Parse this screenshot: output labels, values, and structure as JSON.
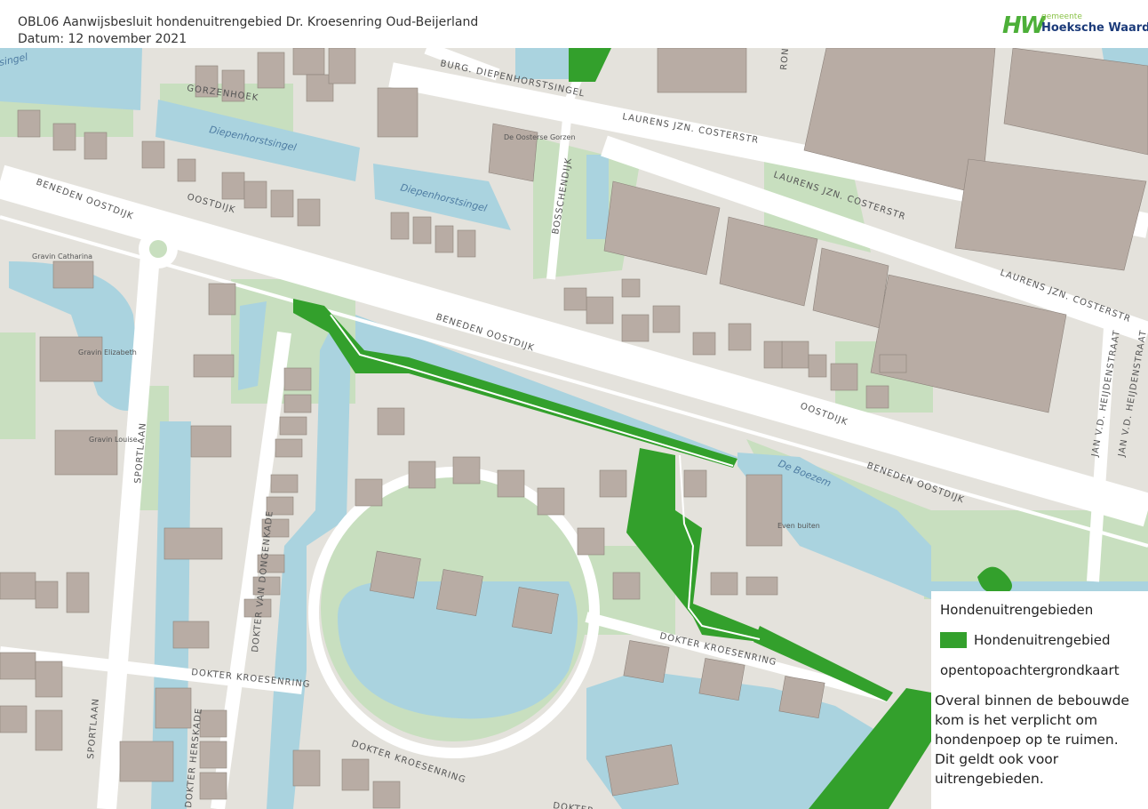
{
  "header": {
    "title": "OBL06 Aanwijsbesluit hondenuitrengebied Dr. Kroesenring Oud-Beijerland",
    "date": "Datum: 12 november 2021"
  },
  "logo": {
    "mark": "HW",
    "prefix": "gemeente",
    "name": "Hoeksche Waard"
  },
  "colors": {
    "dog_area": "#33a02c",
    "water": "#aad3df",
    "green": "#c8dfbf",
    "building": "#b8aca4",
    "road": "#ffffff",
    "ground": "#e4e2dc"
  },
  "map": {
    "streets": {
      "gorzenhoek": "GORZENHOEK",
      "diepenhorstsingel_burg": "BURG. DIEPENHORSTSINGEL",
      "laurens1": "LAURENS JZN. COSTERSTR",
      "laurens2": "LAURENS JZN. COSTERSTR",
      "laurens3": "LAURENS JZN. COSTERSTR",
      "beneden_oostdijk_w": "BENEDEN OOSTDIJK",
      "oostdijk_w": "OOSTDIJK",
      "bosschendijk": "BOSSCHENDIJK",
      "beneden_oostdijk_c": "BENEDEN OOSTDIJK",
      "oostdijk_e": "OOSTDIJK",
      "beneden_oostdijk_e": "BENEDEN OOSTDIJK",
      "heijdenstraat1": "JAN V.D. HEIJDENSTRAAT",
      "heijdenstraat2": "JAN V.D. HEIJDENSTRAAT",
      "sportlaan1": "SPORTLAAN",
      "sportlaan2": "SPORTLAAN",
      "dongenkade": "DOKTER VAN DONGENKADE",
      "kroesenring_w": "DOKTER KROESENRING",
      "kroesenring_c": "DOKTER KROESENRING",
      "kroesenring_e": "DOKTER KROESENRING",
      "kroesenring_s": "DOKTER",
      "herskade": "DOKTER HERSKADE",
      "ront": "RONT"
    },
    "water": {
      "diepenhorstsingel1": "Diepenhorstsingel",
      "diepenhorstsingel2": "Diepenhorstsingel",
      "boezem": "De Boezem",
      "singel": "singel"
    },
    "places": {
      "de_oosterse_gorzen": "De Oosterse Gorzen",
      "gravin_catharina": "Gravin Catharina",
      "gravin_elizabeth": "Gravin Elizabeth",
      "gravin_louise": "Gravin Louise",
      "even_buiten": "Even buiten"
    }
  },
  "legend": {
    "title": "Hondenuitrengebieden",
    "item": "Hondenuitrengebied",
    "layer": "opentopoachtergrondkaart",
    "note": "Overal binnen de bebouwde kom is het verplicht om hondenpoep op te ruimen. Dit geldt ook voor uitrengebieden."
  }
}
